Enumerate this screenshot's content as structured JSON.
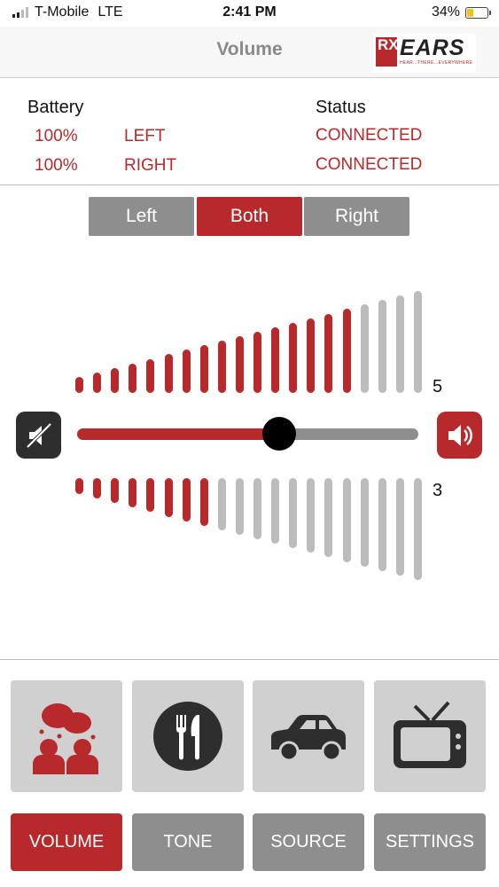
{
  "status_bar": {
    "carrier": "T-Mobile",
    "network": "LTE",
    "time": "2:41 PM",
    "battery_percent": "34%",
    "battery_level": 0.34,
    "signal_bars": 2
  },
  "nav": {
    "title": "Volume",
    "logo": {
      "rx": "RX",
      "brand": "EARS",
      "tagline": "HEAR...THERE...EVERYWHERE"
    }
  },
  "info": {
    "battery_label": "Battery",
    "status_label": "Status",
    "left": {
      "battery": "100%",
      "side": "LEFT",
      "status": "CONNECTED"
    },
    "right": {
      "battery": "100%",
      "side": "RIGHT",
      "status": "CONNECTED"
    }
  },
  "segments": [
    {
      "label": "Left",
      "selected": false
    },
    {
      "label": "Both",
      "selected": true
    },
    {
      "label": "Right",
      "selected": false
    }
  ],
  "volume": {
    "upper_level_label": "5",
    "lower_level_label": "3",
    "bar_count": 20,
    "upper_active_bars": 16,
    "lower_active_bars": 8,
    "slider_fraction": 0.595
  },
  "presets": [
    {
      "icon": "conversation-icon"
    },
    {
      "icon": "restaurant-icon"
    },
    {
      "icon": "car-icon"
    },
    {
      "icon": "tv-icon"
    }
  ],
  "tabs": [
    {
      "label": "VOLUME",
      "selected": true
    },
    {
      "label": "TONE",
      "selected": false
    },
    {
      "label": "SOURCE",
      "selected": false
    },
    {
      "label": "SETTINGS",
      "selected": false
    }
  ],
  "colors": {
    "accent": "#b8292b",
    "inactive": "#8e8e8e",
    "bar_inactive": "#bcbcbc"
  }
}
